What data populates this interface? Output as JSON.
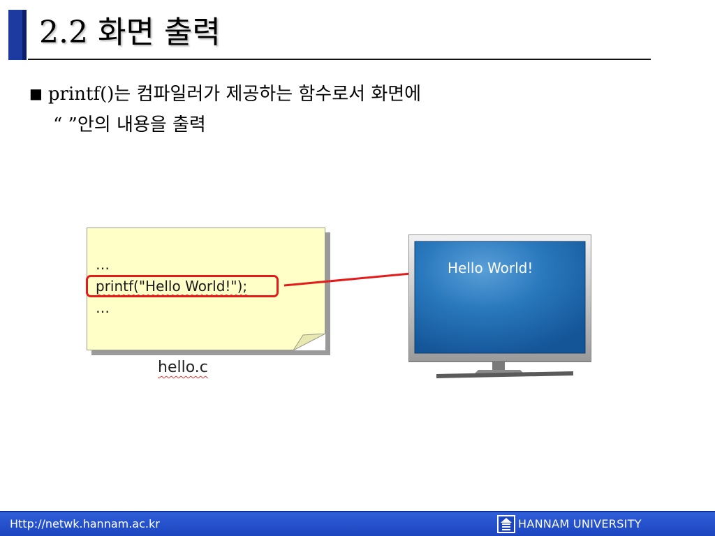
{
  "slide": {
    "title": "2.2 화면 출력",
    "bullet": {
      "marker": "■",
      "line1": "printf()는 컴파일러가 제공하는 함수로서 화면에",
      "line2": "“ ”안의 내용을 출력"
    }
  },
  "diagram": {
    "code_lines": [
      "…",
      "printf(\"Hello World!\");",
      "…"
    ],
    "filename": "hello.c",
    "screen_text": "Hello World!"
  },
  "footer": {
    "url": "Http://netwk.hannam.ac.kr",
    "logo_text": "HAN NAM",
    "university": "HANNAM  UNIVERSITY"
  },
  "colors": {
    "title_accent": "#1c3aa0",
    "highlight": "#e51b1b",
    "note": "#ffffc8",
    "screen": "#1e63a8",
    "footer": "#2450cc"
  }
}
